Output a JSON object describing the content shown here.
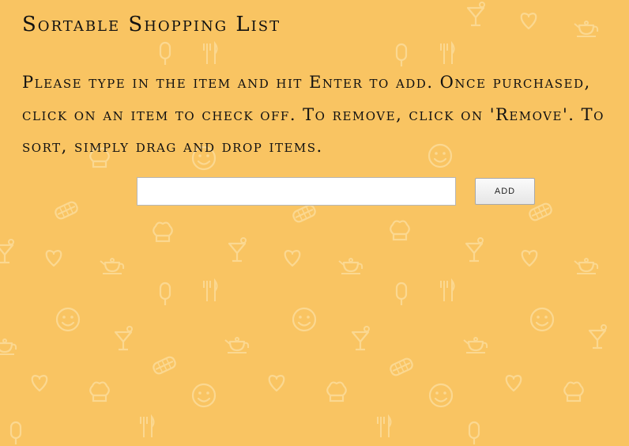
{
  "page": {
    "title": "Sortable Shopping List",
    "instructions": "Please type in the item and hit Enter to add. Once purchased, click on an item to check off. To remove, click on 'Remove'. To sort, simply drag and drop items."
  },
  "form": {
    "item_input_value": "",
    "item_input_placeholder": "",
    "add_label": "ADD"
  },
  "list": {
    "items": []
  },
  "theme": {
    "background_color": "#f9c462",
    "pattern_color": "#fbd891",
    "text_color": "#111111"
  },
  "background_icons": [
    "cocktail-icon",
    "heart-icon",
    "teapot-icon",
    "popsicle-icon",
    "fork-knife-icon",
    "smiley-icon",
    "chef-hat-icon",
    "sandwich-icon"
  ]
}
